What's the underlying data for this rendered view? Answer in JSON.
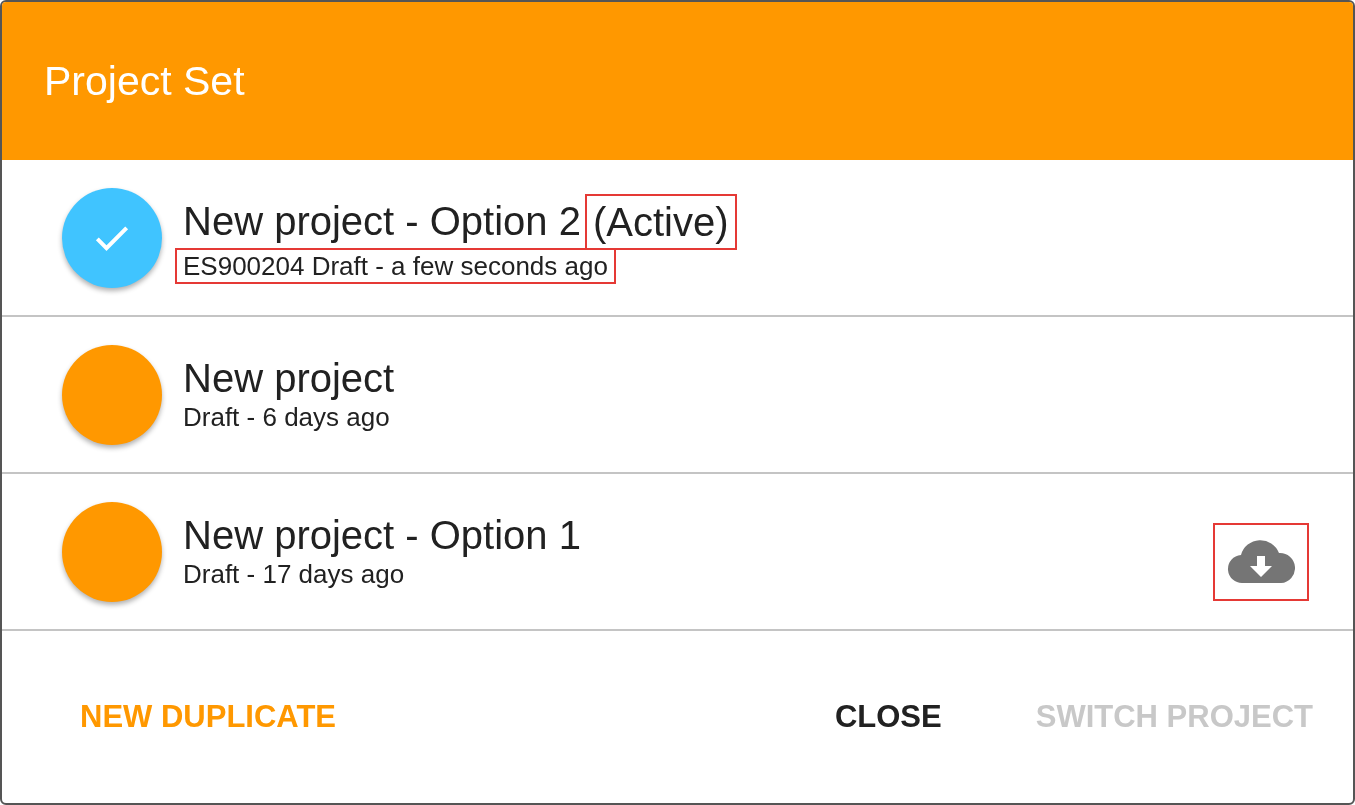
{
  "dialog": {
    "title": "Project Set"
  },
  "projects": [
    {
      "title": "New project - Option 2",
      "status": "(Active)",
      "subtitle": "ES900204 Draft - a few seconds ago",
      "active": true,
      "status_highlighted": true,
      "subtitle_highlighted": true
    },
    {
      "title": "New project",
      "subtitle": "Draft - 6 days ago",
      "active": false
    },
    {
      "title": "New project - Option 1",
      "subtitle": "Draft - 17 days ago",
      "active": false,
      "download": true,
      "download_highlighted": true
    }
  ],
  "buttons": [
    {
      "label": "NEW DUPLICATE",
      "kind": "accent",
      "disabled": false
    },
    {
      "label": "CLOSE",
      "kind": "plain",
      "disabled": false
    },
    {
      "label": "SWITCH PROJECT",
      "kind": "plain",
      "disabled": true
    }
  ]
}
